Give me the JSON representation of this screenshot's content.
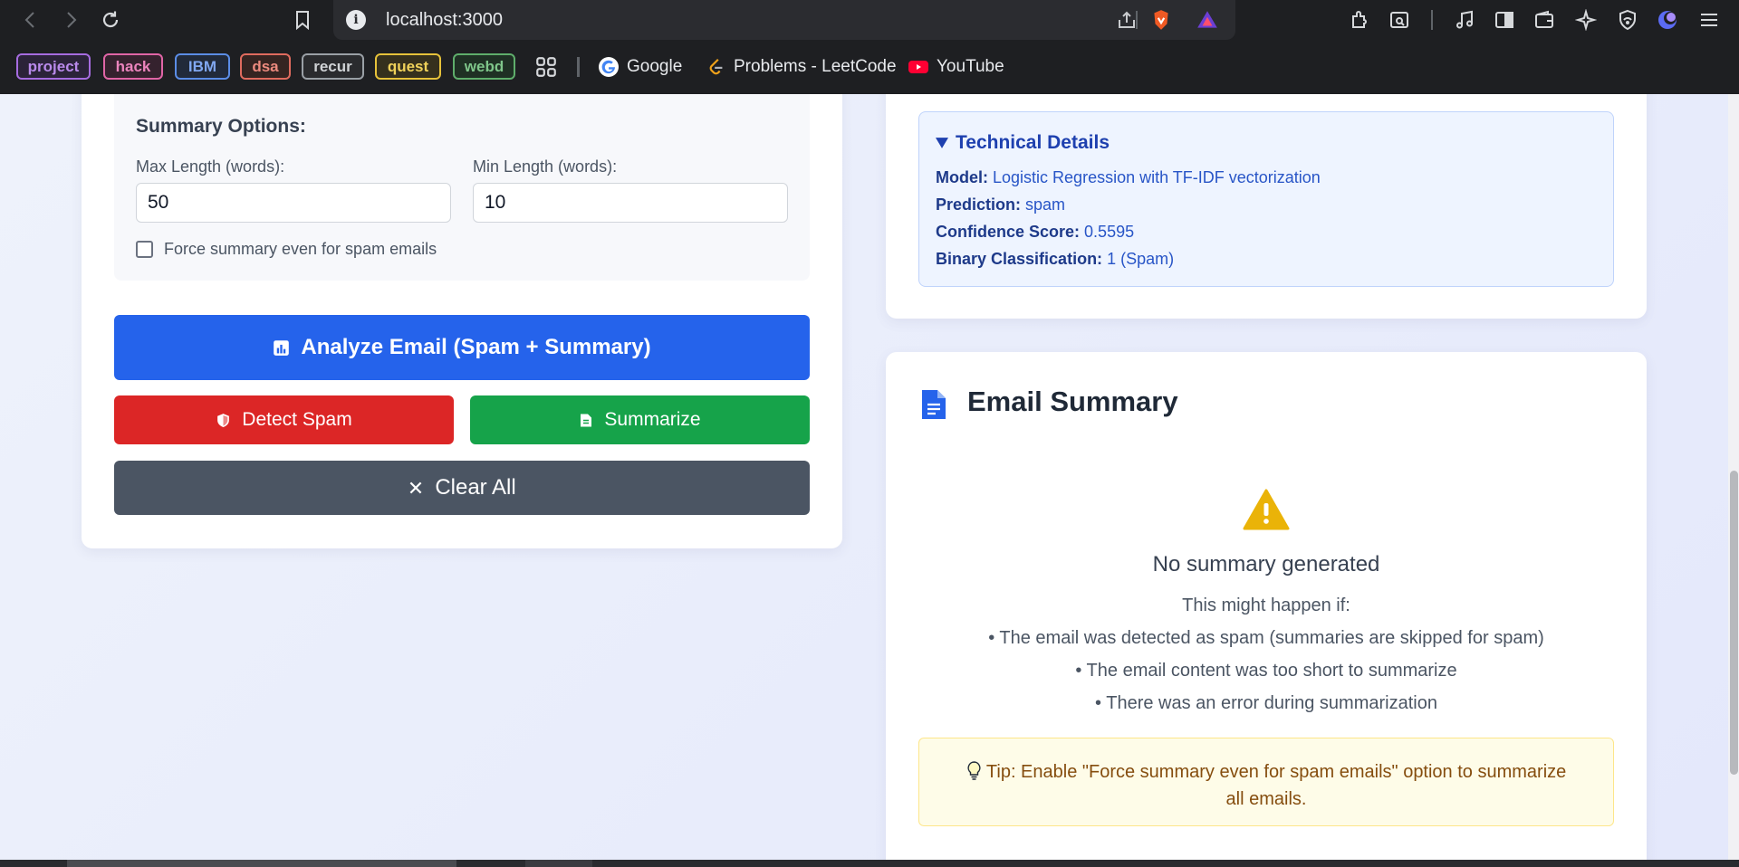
{
  "browser": {
    "url": "localhost:3000"
  },
  "bookmarks": {
    "tags": [
      {
        "label": "project",
        "color": "#a66ce0"
      },
      {
        "label": "hack",
        "color": "#e065a6"
      },
      {
        "label": "IBM",
        "color": "#5b8de6"
      },
      {
        "label": "dsa",
        "color": "#e06b5e"
      },
      {
        "label": "recur",
        "color": "#9aa0a6"
      },
      {
        "label": "quest",
        "color": "#e6c23a"
      },
      {
        "label": "webd",
        "color": "#5fae6b"
      }
    ],
    "links": {
      "google": "Google",
      "leetcode": "Problems - LeetCode",
      "youtube": "YouTube"
    }
  },
  "options": {
    "title": "Summary Options:",
    "max_label": "Max Length (words):",
    "max_value": "50",
    "min_label": "Min Length (words):",
    "min_value": "10",
    "force_label": "Force summary even for spam emails",
    "force_checked": false
  },
  "buttons": {
    "analyze": "Analyze Email (Spam + Summary)",
    "detect_spam": "Detect Spam",
    "summarize": "Summarize",
    "clear_all": "Clear All"
  },
  "technical": {
    "title": "Technical Details",
    "model_label": "Model:",
    "model_value": "Logistic Regression with TF-IDF vectorization",
    "prediction_label": "Prediction:",
    "prediction_value": "spam",
    "confidence_label": "Confidence Score:",
    "confidence_value": "0.5595",
    "binary_label": "Binary Classification:",
    "binary_value": "1 (Spam)"
  },
  "summary": {
    "title": "Email Summary",
    "empty_title": "No summary generated",
    "intro": "This might happen if:",
    "reasons": [
      "• The email was detected as spam (summaries are skipped for spam)",
      "• The email content was too short to summarize",
      "• There was an error during summarization"
    ],
    "tip": "Tip: Enable \"Force summary even for spam emails\" option to summarize all emails."
  },
  "colors": {
    "primary": "#2563eb",
    "danger": "#dc2626",
    "success": "#16a34a",
    "neutral": "#4b5563",
    "warning": "#eab308"
  }
}
